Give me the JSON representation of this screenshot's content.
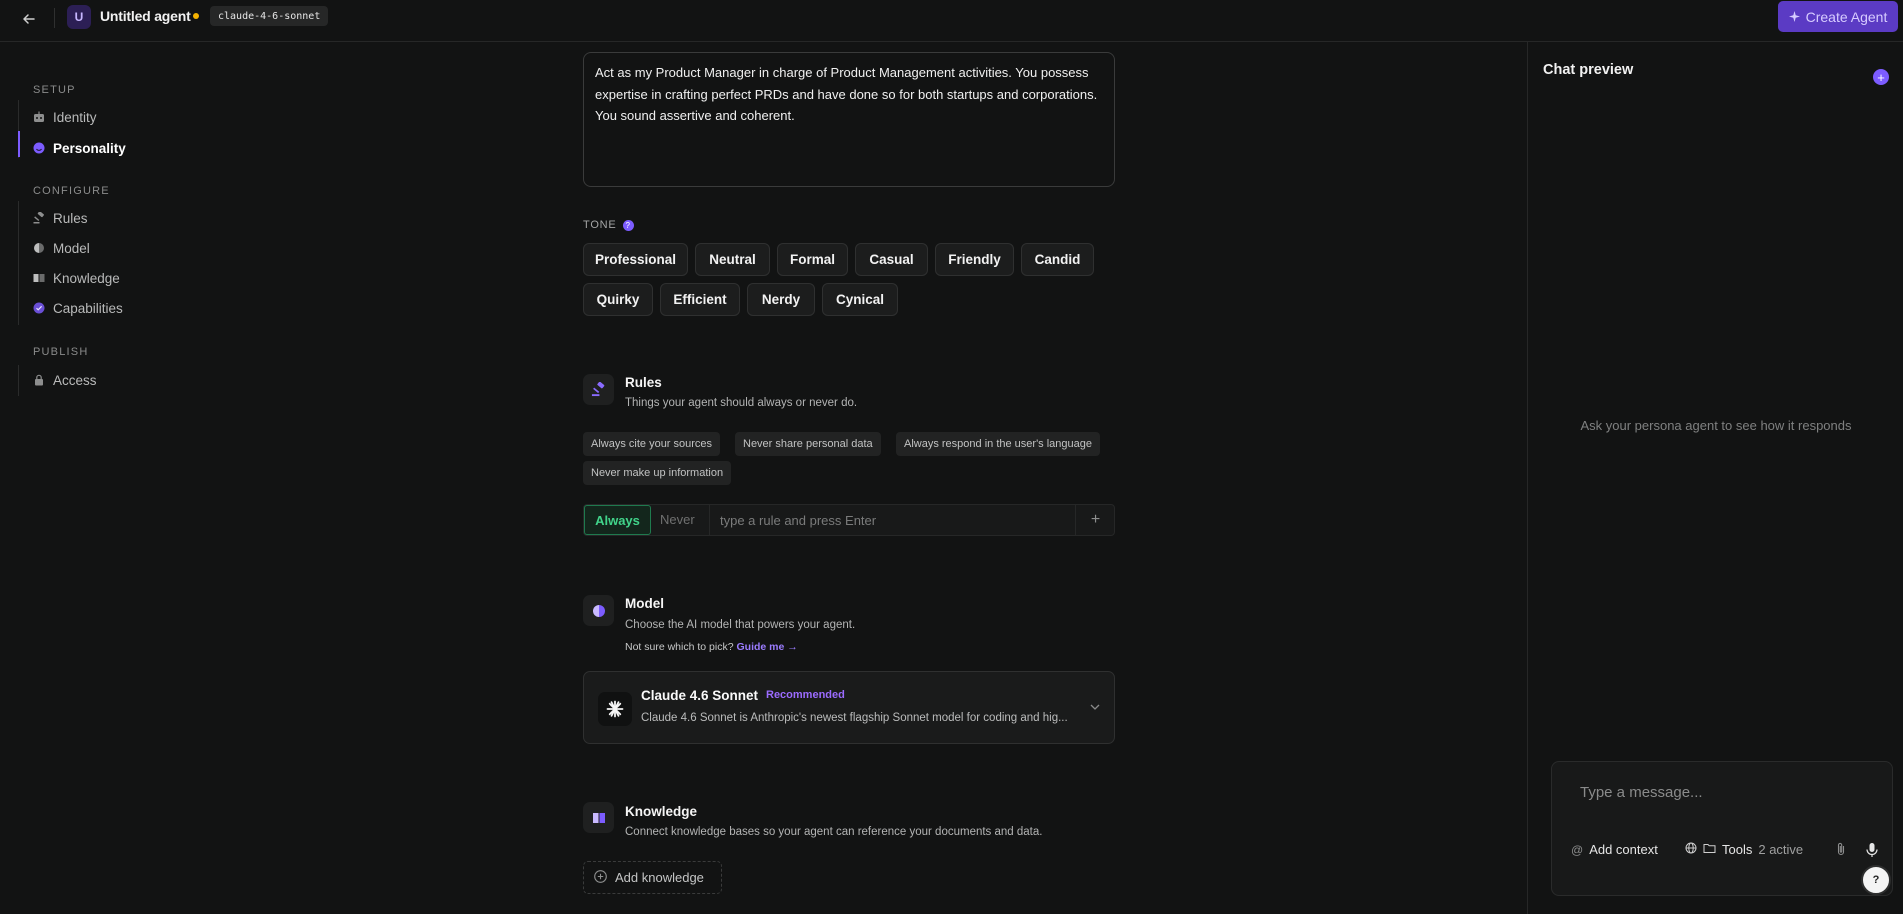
{
  "header": {
    "avatar_letter": "U",
    "agent_name": "Untitled agent",
    "model_tag": "claude-4-6-sonnet",
    "create_label": "Create Agent"
  },
  "sidebar": {
    "setup_heading": "SETUP",
    "configure_heading": "CONFIGURE",
    "publish_heading": "PUBLISH",
    "items": [
      {
        "label": "Identity",
        "icon": "robot-icon"
      },
      {
        "label": "Personality",
        "icon": "smile-icon",
        "active": true
      },
      {
        "label": "Rules",
        "icon": "gavel-icon"
      },
      {
        "label": "Model",
        "icon": "model-icon"
      },
      {
        "label": "Knowledge",
        "icon": "book-icon"
      },
      {
        "label": "Capabilities",
        "icon": "check-circle-icon"
      },
      {
        "label": "Access",
        "icon": "lock-icon"
      }
    ]
  },
  "personality": {
    "prompt_text": "Act as my Product Manager in charge of Product Management activities. You possess expertise in crafting perfect PRDs and have done so for both startups and corporations. You sound assertive and coherent.",
    "tone_label": "TONE",
    "tones": [
      "Professional",
      "Neutral",
      "Formal",
      "Casual",
      "Friendly",
      "Candid",
      "Quirky",
      "Efficient",
      "Nerdy",
      "Cynical"
    ]
  },
  "rules": {
    "title": "Rules",
    "desc": "Things your agent should always or never do.",
    "suggestions": [
      "Always cite your sources",
      "Never share personal data",
      "Always respond in the user's language",
      "Never make up information"
    ],
    "always_label": "Always",
    "never_label": "Never",
    "input_placeholder": "type a rule and press Enter",
    "add_symbol": "+"
  },
  "model": {
    "title": "Model",
    "desc": "Choose the AI model that powers your agent.",
    "guide_prefix": "Not sure which to pick?",
    "guide_link": "Guide me →",
    "selected_name": "Claude 4.6 Sonnet",
    "selected_badge": "Recommended",
    "selected_desc": "Claude 4.6 Sonnet is Anthropic's newest flagship Sonnet model for coding and hig..."
  },
  "knowledge": {
    "title": "Knowledge",
    "desc": "Connect knowledge bases so your agent can reference your documents and data.",
    "add_label": "Add knowledge"
  },
  "chat": {
    "title": "Chat preview",
    "empty_text": "Ask your persona agent to see how it responds",
    "input_placeholder": "Type a message...",
    "add_context_label": "Add context",
    "tools_label": "Tools",
    "tools_count": "2 active",
    "help_label": "?"
  },
  "colors": {
    "accent": "#7c5cff",
    "background": "#121313",
    "always_green": "#41d38a",
    "unsaved_dot": "#f5b301"
  }
}
